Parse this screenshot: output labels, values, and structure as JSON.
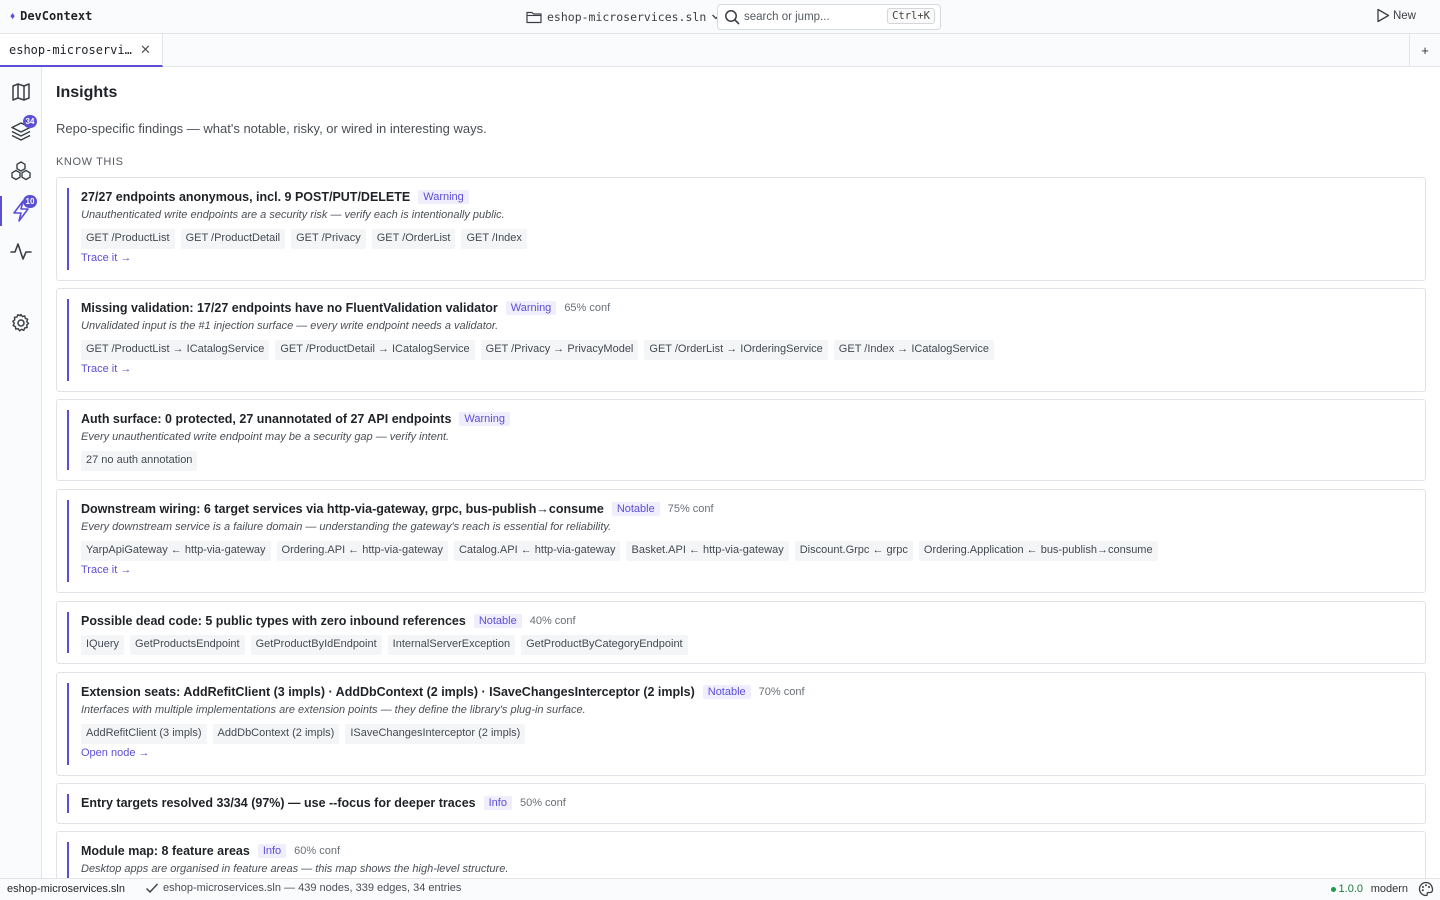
{
  "app": {
    "title": "DevContext"
  },
  "project": {
    "name": "eshop-microservices.sln"
  },
  "search": {
    "placeholder": "search or jump...",
    "shortcut": "Ctrl+K"
  },
  "toolbar": {
    "new_label": "New"
  },
  "tabs": [
    {
      "label": "eshop-microservices.sln"
    }
  ],
  "sidebar": {
    "items": [
      {
        "icon": "map-icon",
        "badge": ""
      },
      {
        "icon": "layers-icon",
        "badge": "34"
      },
      {
        "icon": "components-icon",
        "badge": ""
      },
      {
        "icon": "lightning-icon",
        "badge": "10",
        "active": true
      },
      {
        "icon": "pulse-icon",
        "badge": ""
      },
      {
        "icon": "gear-icon",
        "badge": ""
      }
    ]
  },
  "page": {
    "title": "Insights",
    "subtitle": "Repo-specific findings — what's notable, risky, or wired in interesting ways.",
    "section": "KNOW THIS"
  },
  "insights": [
    {
      "title": "27/27 endpoints anonymous, incl. 9 POST/PUT/DELETE",
      "tag": "Warning",
      "conf": "",
      "desc": "Unauthenticated write endpoints are a security risk — verify each is intentionally public.",
      "chips": [
        "GET /ProductList",
        "GET /ProductDetail",
        "GET /Privacy",
        "GET /OrderList",
        "GET /Index"
      ],
      "link": "Trace it →"
    },
    {
      "title": "Missing validation: 17/27 endpoints have no FluentValidation validator",
      "tag": "Warning",
      "conf": "65% conf",
      "desc": "Unvalidated input is the #1 injection surface — every write endpoint needs a validator.",
      "chips": [
        "GET /ProductList → ICatalogService",
        "GET /ProductDetail → ICatalogService",
        "GET /Privacy → PrivacyModel",
        "GET /OrderList → IOrderingService",
        "GET /Index → ICatalogService"
      ],
      "link": "Trace it →"
    },
    {
      "title": "Auth surface: 0 protected, 27 unannotated of 27 API endpoints",
      "tag": "Warning",
      "conf": "",
      "desc": "Every unauthenticated write endpoint may be a security gap — verify intent.",
      "chips": [
        "27 no auth annotation"
      ],
      "link": ""
    },
    {
      "title": "Downstream wiring: 6 target services via http-via-gateway, grpc, bus-publish→consume",
      "tag": "Notable",
      "conf": "75% conf",
      "desc": "Every downstream service is a failure domain — understanding the gateway's reach is essential for reliability.",
      "chips": [
        "YarpApiGateway ← http-via-gateway",
        "Ordering.API ← http-via-gateway",
        "Catalog.API ← http-via-gateway",
        "Basket.API ← http-via-gateway",
        "Discount.Grpc ← grpc",
        "Ordering.Application ← bus-publish→consume"
      ],
      "link": "Trace it →"
    },
    {
      "title": "Possible dead code: 5 public types with zero inbound references",
      "tag": "Notable",
      "conf": "40% conf",
      "desc": "",
      "chips": [
        "IQuery",
        "GetProductsEndpoint",
        "GetProductByIdEndpoint",
        "InternalServerException",
        "GetProductByCategoryEndpoint"
      ],
      "link": ""
    },
    {
      "title": "Extension seats: AddRefitClient (3 impls) · AddDbContext (2 impls) · ISaveChangesInterceptor (2 impls)",
      "tag": "Notable",
      "conf": "70% conf",
      "desc": "Interfaces with multiple implementations are extension points — they define the library's plug-in surface.",
      "chips": [
        "AddRefitClient (3 impls)",
        "AddDbContext (2 impls)",
        "ISaveChangesInterceptor (2 impls)"
      ],
      "link": "Open node →"
    },
    {
      "title": "Entry targets resolved 33/34 (97%) — use --focus for deeper traces",
      "tag": "Info",
      "conf": "50% conf",
      "desc": "",
      "chips": [],
      "link": ""
    },
    {
      "title": "Module map: 8 feature areas",
      "tag": "Info",
      "conf": "60% conf",
      "desc": "Desktop apps are organised in feature areas — this map shows the high-level structure.",
      "chips": [],
      "link": ""
    }
  ],
  "status": {
    "file": "eshop-microservices.sln",
    "message": "eshop-microservices.sln — 439 nodes, 339 edges, 34 entries",
    "version": "1.0.0",
    "mode": "modern"
  },
  "colors": {
    "accent": "#5b4fd6",
    "ok": "#1f9d4a"
  }
}
